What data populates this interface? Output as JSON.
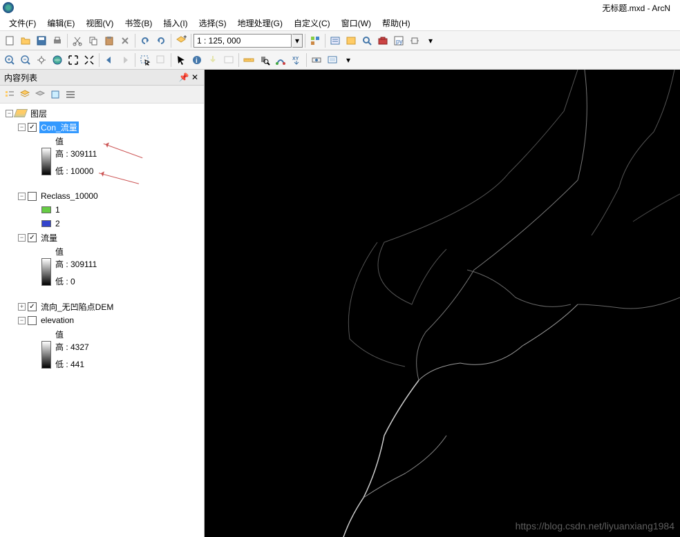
{
  "window": {
    "title": "无标题.mxd - ArcN"
  },
  "menu": {
    "file": "文件(F)",
    "edit": "编辑(E)",
    "view": "视图(V)",
    "bookmarks": "书签(B)",
    "insert": "插入(I)",
    "selection": "选择(S)",
    "geoprocessing": "地理处理(G)",
    "customize": "自定义(C)",
    "window": "窗口(W)",
    "help": "帮助(H)"
  },
  "toolbar": {
    "scale": "1 : 125, 000"
  },
  "toc": {
    "title": "内容列表",
    "root": "图层",
    "layers": [
      {
        "name": "Con_流量",
        "checked": true,
        "selected": true,
        "value_label": "值",
        "high": "高 : 309111",
        "low": "低 : 10000"
      },
      {
        "name": "Reclass_10000",
        "checked": false,
        "classes": [
          {
            "label": "1",
            "color": "#66cc44"
          },
          {
            "label": "2",
            "color": "#3344cc"
          }
        ]
      },
      {
        "name": "流量",
        "checked": true,
        "value_label": "值",
        "high": "高 : 309111",
        "low": "低 : 0"
      },
      {
        "name": "流向_无凹陷点DEM",
        "checked": true,
        "collapsed": true
      },
      {
        "name": "elevation",
        "checked": false,
        "value_label": "值",
        "high": "高 : 4327",
        "low": "低 : 441"
      }
    ]
  },
  "watermark": "https://blog.csdn.net/liyuanxiang1984"
}
